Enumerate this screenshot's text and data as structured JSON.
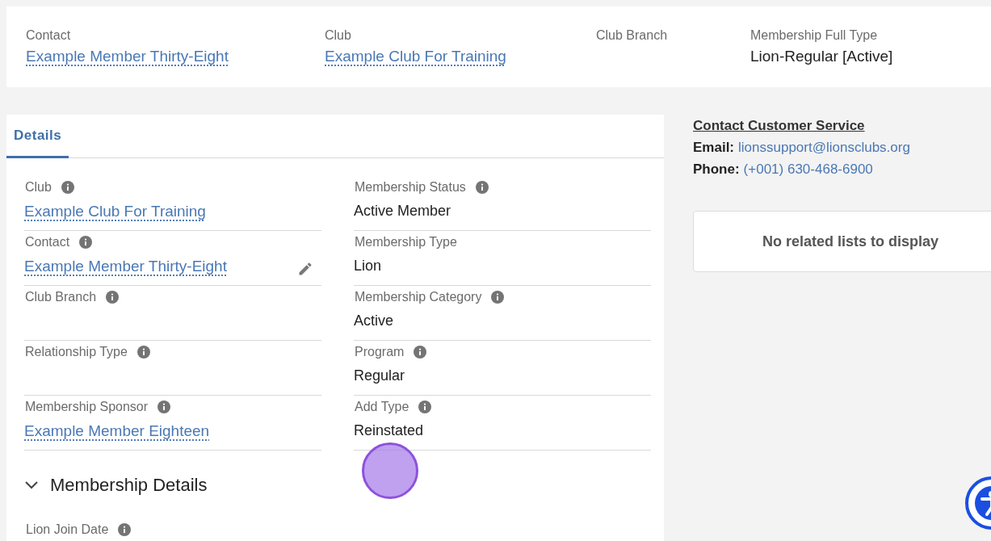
{
  "header": {
    "fields": [
      {
        "label": "Contact",
        "value": "Example Member Thirty-Eight",
        "kind": "link"
      },
      {
        "label": "Club",
        "value": "Example Club For Training",
        "kind": "link"
      },
      {
        "label": "Club Branch",
        "kind": "text"
      },
      {
        "label": "Membership Full Type",
        "value": "Lion-Regular [Active]",
        "kind": "text"
      }
    ]
  },
  "tabs": [
    {
      "label": "Details",
      "selected": true
    }
  ],
  "fields": [
    {
      "label": "Club",
      "value": "Example Club For Training",
      "kind": "link",
      "info": true,
      "editable": false
    },
    {
      "label": "Membership Status",
      "value": "Active Member",
      "kind": "text",
      "info": true,
      "editable": false
    },
    {
      "label": "Contact",
      "value": "Example Member Thirty-Eight",
      "kind": "link",
      "info": true,
      "editable": true
    },
    {
      "label": "Membership Type",
      "value": "Lion",
      "kind": "text",
      "info": false,
      "editable": false
    },
    {
      "label": "Club Branch",
      "kind": "text",
      "info": true,
      "editable": false
    },
    {
      "label": "Membership Category",
      "value": "Active",
      "kind": "text",
      "info": true,
      "editable": false
    },
    {
      "label": "Relationship Type",
      "kind": "text",
      "info": true,
      "editable": false
    },
    {
      "label": "Program",
      "value": "Regular",
      "kind": "text",
      "info": true,
      "editable": false
    },
    {
      "label": "Membership Sponsor",
      "value": "Example Member Eighteen",
      "kind": "link",
      "info": true,
      "editable": false
    },
    {
      "label": "Add Type",
      "value": "Reinstated",
      "kind": "text",
      "info": true,
      "editable": false
    }
  ],
  "section": {
    "title": "Membership Details",
    "expanded": true,
    "fields": [
      {
        "label": "Lion Join Date",
        "info": true
      }
    ]
  },
  "contact_service": {
    "title": "Contact Customer Service",
    "lines": [
      {
        "label": "Email:",
        "value": "lionssupport@lionsclubs.org"
      },
      {
        "label": "Phone:",
        "value": "(+001) 630-468-6900"
      }
    ]
  },
  "related": {
    "message": "No related lists to display"
  }
}
